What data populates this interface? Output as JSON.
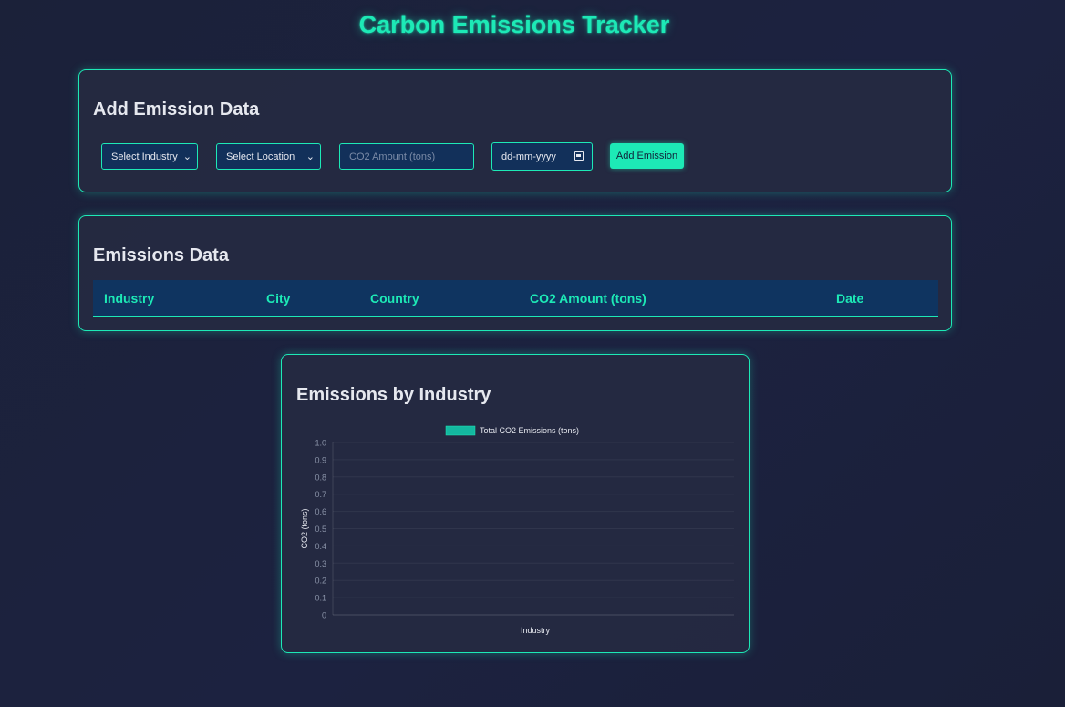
{
  "app": {
    "title": "Carbon Emissions Tracker"
  },
  "add_form": {
    "heading": "Add Emission Data",
    "industry_select": "Select Industry",
    "location_select": "Select Location",
    "co2_placeholder": "CO2 Amount (tons)",
    "date_placeholder": "dd-mm-yyyy",
    "add_button": "Add Emission"
  },
  "table": {
    "heading": "Emissions Data",
    "columns": [
      "Industry",
      "City",
      "Country",
      "CO2 Amount (tons)",
      "Date"
    ],
    "rows": []
  },
  "chart_panel": {
    "heading": "Emissions by Industry"
  },
  "chart_data": {
    "type": "bar",
    "categories": [],
    "series": [
      {
        "name": "Total CO2 Emissions (tons)",
        "values": [],
        "color": "#14b8a0"
      }
    ],
    "title": "",
    "xlabel": "Industry",
    "ylabel": "CO2 (tons)",
    "ylim": [
      0,
      1.0
    ],
    "yticks": [
      "0",
      "0.1",
      "0.2",
      "0.3",
      "0.4",
      "0.5",
      "0.6",
      "0.7",
      "0.8",
      "0.9",
      "1.0"
    ],
    "grid": true,
    "legend": "top-center"
  },
  "colors": {
    "accent": "#1de9b6",
    "header_bg": "#0f3460",
    "page_bg": "#1b2139"
  }
}
